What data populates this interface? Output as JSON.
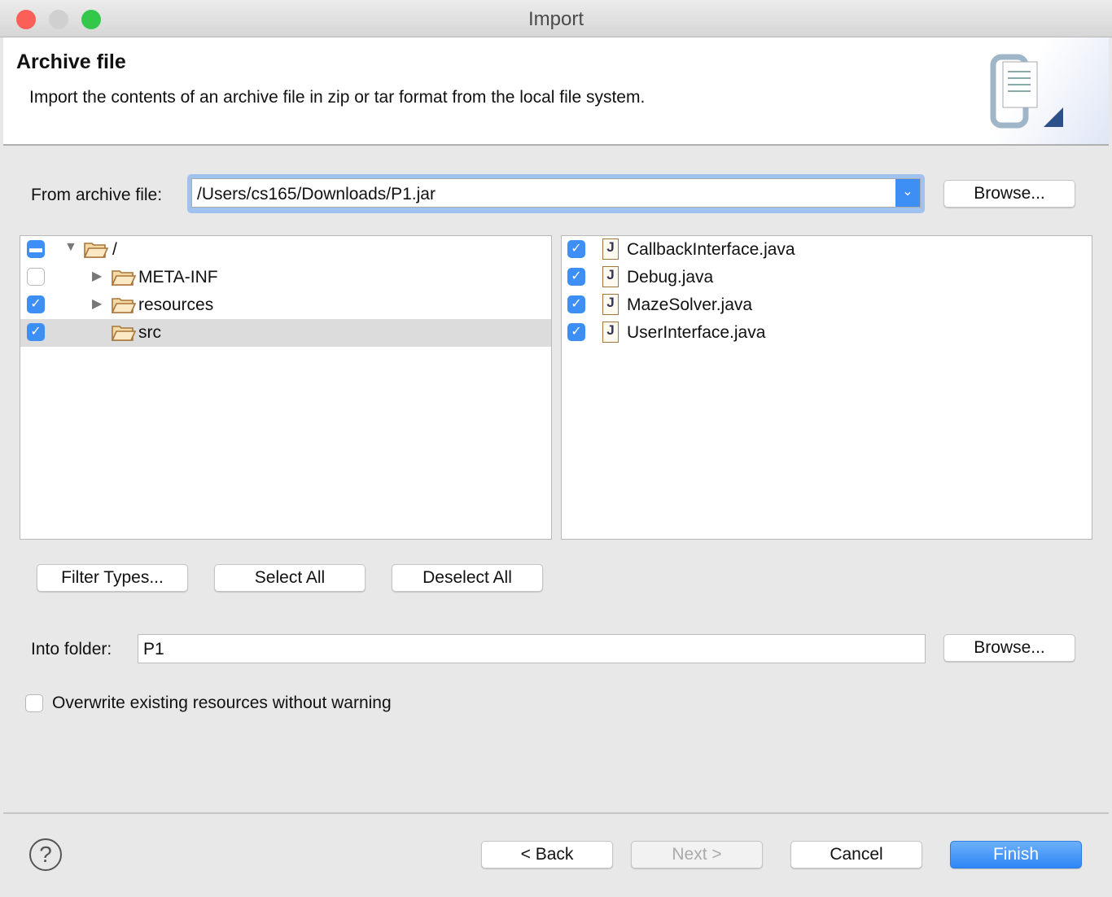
{
  "window": {
    "title": "Import"
  },
  "header": {
    "title": "Archive file",
    "description": "Import the contents of an archive file in zip or tar format from the local file system.",
    "icon": "archive-import-icon"
  },
  "archive": {
    "label": "From archive file:",
    "value": "/Users/cs165/Downloads/P1.jar",
    "browse": "Browse..."
  },
  "tree": [
    {
      "label": "/",
      "state": "partial",
      "expanded": true
    },
    {
      "label": "META-INF",
      "state": "unchecked",
      "expanded": false
    },
    {
      "label": "resources",
      "state": "checked",
      "expanded": false
    },
    {
      "label": "src",
      "state": "checked",
      "selected": true
    }
  ],
  "files": [
    {
      "label": "CallbackInterface.java",
      "checked": true
    },
    {
      "label": "Debug.java",
      "checked": true
    },
    {
      "label": "MazeSolver.java",
      "checked": true
    },
    {
      "label": "UserInterface.java",
      "checked": true
    }
  ],
  "buttons": {
    "filter": "Filter Types...",
    "select_all": "Select All",
    "deselect_all": "Deselect All"
  },
  "folder": {
    "label": "Into folder:",
    "value": "P1",
    "browse": "Browse..."
  },
  "overwrite": {
    "label": "Overwrite existing resources without warning",
    "checked": false
  },
  "footer": {
    "back": "< Back",
    "next": "Next >",
    "cancel": "Cancel",
    "finish": "Finish",
    "help": "?"
  },
  "colors": {
    "accent": "#3d8ef5",
    "close": "#fc5f57",
    "minimize": "#d0d0d0",
    "maximize": "#34c84a"
  }
}
